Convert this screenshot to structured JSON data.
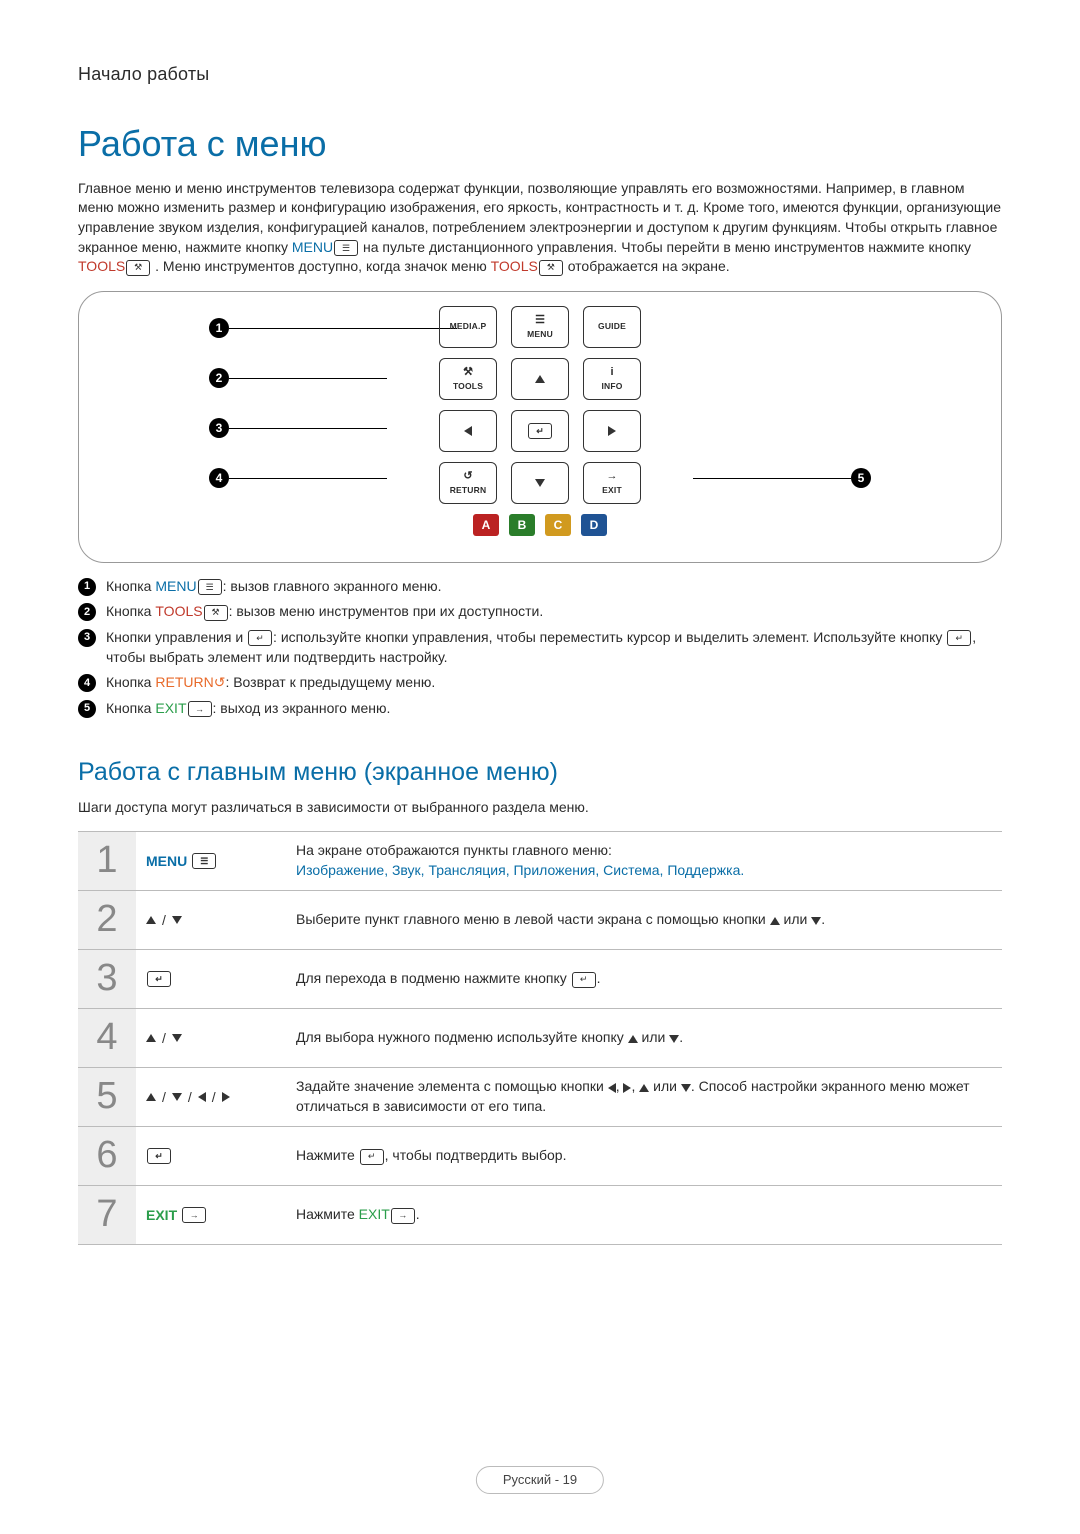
{
  "header": {
    "section": "Начало работы"
  },
  "title": "Работа с меню",
  "intro": {
    "text_before_menu": "Главное меню и меню инструментов телевизора содержат функции, позволяющие управлять его возможностями. Например, в главном меню можно изменить размер и конфигурацию изображения, его яркость, контрастность и т. д. Кроме того, имеются функции, организующие управление звуком изделия, конфигурацией каналов, потреблением электроэнергии и доступом к другим функциям. Чтобы открыть главное экранное меню, нажмите кнопку ",
    "menu_word": "MENU",
    "text_mid": " на пульте дистанционного управления. Чтобы перейти в меню инструментов нажмите кнопку ",
    "tools_word": "TOOLS",
    "text_after_tools": ". Меню инструментов доступно, когда значок меню ",
    "tools_word2": "TOOLS",
    "text_tail": " отображается на экране."
  },
  "remote": {
    "row1": {
      "a": "MEDIA.P",
      "b_top": "",
      "b": "MENU",
      "c": "GUIDE"
    },
    "row2": {
      "a": "TOOLS",
      "b_arrow": "up",
      "c": "INFO",
      "c_top": "i"
    },
    "row3": {
      "a_arrow": "left",
      "b": "↵",
      "c_arrow": "right"
    },
    "row4": {
      "a": "RETURN",
      "a_top": "↺",
      "b_arrow": "down",
      "c": "EXIT",
      "c_top": "→"
    },
    "colors": {
      "a": "A",
      "b": "B",
      "c": "C",
      "d": "D"
    },
    "markers": [
      "1",
      "2",
      "3",
      "4",
      "5"
    ]
  },
  "legend": [
    {
      "n": "1",
      "html": "Кнопка <span class='c-menu'>MENU<span class='iconbox'>☰</span></span>: вызов главного экранного меню."
    },
    {
      "n": "2",
      "html": "Кнопка <span class='c-tools'>TOOLS<span class='iconbox'>⚒</span></span>: вызов меню инструментов при их доступности."
    },
    {
      "n": "3",
      "html": "Кнопки управления и <span class='iconbox'>↵</span>: используйте кнопки управления, чтобы переместить курсор и выделить элемент. Используйте кнопку <span class='iconbox'>↵</span>, чтобы выбрать элемент или подтвердить настройку."
    },
    {
      "n": "4",
      "html": "Кнопка <span class='c-return'>RETURN↺</span>: Возврат к предыдущему меню."
    },
    {
      "n": "5",
      "html": "Кнопка <span class='c-exit'>EXIT<span class='iconbox'>→</span></span>: выход из экранного меню."
    }
  ],
  "subheading": "Работа с главным меню (экранное меню)",
  "sub_desc": "Шаги доступа могут различаться в зависимости от выбранного раздела меню.",
  "steps": [
    {
      "n": "1",
      "key_type": "menu",
      "key_label": "MENU",
      "desc_line1": "На экране отображаются пункты главного меню:",
      "desc_colors": "Изображение, Звук, Трансляция, Приложения, Система, Поддержка."
    },
    {
      "n": "2",
      "key_type": "ud",
      "desc": "Выберите пункт главного меню в левой части экрана с помощью кнопки <span class='tri tri-up'></span> или <span class='tri tri-down'></span>."
    },
    {
      "n": "3",
      "key_type": "enter",
      "desc": "Для перехода в подменю нажмите кнопку <span class='iconbox'>↵</span>."
    },
    {
      "n": "4",
      "key_type": "ud",
      "desc": "Для выбора нужного подменю используйте кнопку <span class='tri tri-up'></span> или <span class='tri tri-down'></span>."
    },
    {
      "n": "5",
      "key_type": "udlr",
      "desc": "Задайте значение элемента с помощью кнопки <span class='tri tri-left'></span>, <span class='tri tri-right'></span>, <span class='tri tri-up'></span> или <span class='tri tri-down'></span>. Способ настройки экранного меню может отличаться в зависимости от его типа."
    },
    {
      "n": "6",
      "key_type": "enter",
      "desc": "Нажмите <span class='iconbox'>↵</span>, чтобы подтвердить выбор."
    },
    {
      "n": "7",
      "key_type": "exit",
      "key_label": "EXIT",
      "desc": "Нажмите <span class='c-exit'>EXIT<span class='iconbox'>→</span></span>."
    }
  ],
  "footer": "Русский - 19"
}
